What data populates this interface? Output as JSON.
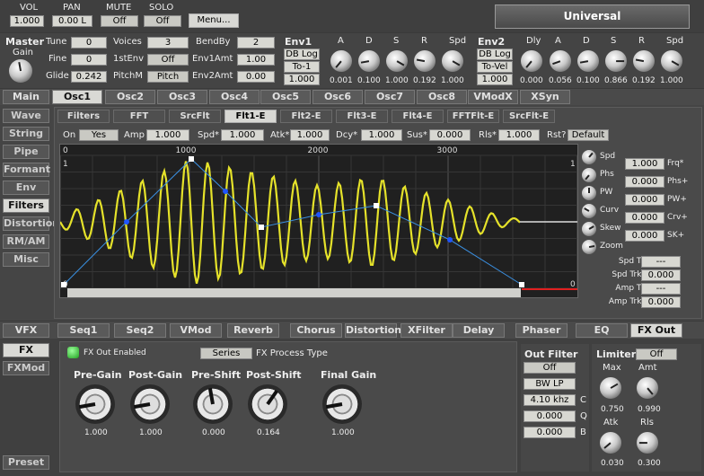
{
  "top": {
    "vol_label": "VOL",
    "vol": "1.000",
    "pan_label": "PAN",
    "pan": "0.00 L",
    "mute_label": "MUTE",
    "mute": "Off",
    "solo_label": "SOLO",
    "solo": "Off",
    "menu": "Menu...",
    "patch": "Universal"
  },
  "master": {
    "title": "Master",
    "gain": "Gain"
  },
  "params": {
    "tune_l": "Tune",
    "tune": "0",
    "fine_l": "Fine",
    "fine": "0",
    "glide_l": "Glide",
    "glide": "0.242",
    "voices_l": "Voices",
    "voices": "3",
    "firstenv_l": "1stEnv",
    "firstenv": "Off",
    "pitchm_l": "PitchM",
    "pitchm": "Pitch",
    "bendby_l": "BendBy",
    "bendby": "2",
    "env1amt_l": "Env1Amt",
    "env1amt": "1.00",
    "env2amt_l": "Env2Amt",
    "env2amt": "0.00"
  },
  "env1": {
    "title": "Env1",
    "mode": "DB Log",
    "target": "To-1",
    "val": "1.000",
    "labels": [
      "A",
      "D",
      "S",
      "R",
      "Spd"
    ],
    "values": [
      "0.001",
      "0.100",
      "1.000",
      "0.192",
      "1.000"
    ]
  },
  "env2": {
    "title": "Env2",
    "mode": "DB Log",
    "target": "To-Vel",
    "val": "1.000",
    "labels": [
      "Dly",
      "A",
      "D",
      "S",
      "R",
      "Spd"
    ],
    "values": [
      "0.000",
      "0.056",
      "0.100",
      "0.866",
      "0.192",
      "1.000"
    ]
  },
  "main_tabs": [
    "Main",
    "Osc1",
    "Osc2",
    "Osc3",
    "Osc4",
    "Osc5",
    "Osc6",
    "Osc7",
    "Osc8",
    "VModX",
    "XSyn"
  ],
  "side_tabs": [
    "Wave",
    "String",
    "Pipe",
    "Formant",
    "Env",
    "Filters",
    "Distortion",
    "RM/AM",
    "Misc"
  ],
  "filter_tabs": [
    "Filters",
    "FFT",
    "SrcFlt",
    "Flt1-E",
    "Flt2-E",
    "Flt3-E",
    "Flt4-E",
    "FFTFlt-E",
    "SrcFlt-E"
  ],
  "envrow": {
    "on_l": "On",
    "on": "Yes",
    "amp_l": "Amp",
    "amp": "1.000",
    "spd_l": "Spd*",
    "spd": "1.000",
    "atk_l": "Atk*",
    "atk": "1.000",
    "dcy_l": "Dcy*",
    "dcy": "1.000",
    "sus_l": "Sus*",
    "sus": "0.000",
    "rls_l": "Rls*",
    "rls": "1.000",
    "rst_l": "Rst?",
    "rst": "Default"
  },
  "graph": {
    "ticks": [
      "0",
      "1000",
      "2000",
      "3000"
    ],
    "corner_tl": "1",
    "corner_tr": "1",
    "corner_bl": "0",
    "corner_br": "0"
  },
  "rightknobs": [
    {
      "label": "Spd"
    },
    {
      "label": "Phs"
    },
    {
      "label": "PW"
    },
    {
      "label": "Curv"
    },
    {
      "label": "Skew"
    },
    {
      "label": "Zoom"
    }
  ],
  "rightfields": [
    {
      "label": "Frq*",
      "value": "1.000"
    },
    {
      "label": "Phs+",
      "value": "0.000"
    },
    {
      "label": "PW+",
      "value": "0.000"
    },
    {
      "label": "Crv+",
      "value": "0.000"
    },
    {
      "label": "SK+",
      "value": "0.000"
    }
  ],
  "trk": [
    {
      "label": "Spd Trk",
      "value": "---"
    },
    {
      "label": "Spd Trk+",
      "value": "0.000"
    },
    {
      "label": "Amp Trk",
      "value": "---"
    },
    {
      "label": "Amp Trk+",
      "value": "0.000"
    }
  ],
  "fx_tabs": [
    "VFX",
    "Seq1",
    "Seq2",
    "VMod",
    "Reverb",
    "Chorus",
    "Distortion",
    "XFilter",
    "Delay",
    "Phaser",
    "EQ",
    "FX Out"
  ],
  "fx_side": [
    "FX",
    "FXMod"
  ],
  "preset": "Preset",
  "fxout": {
    "enabled": "FX Out Enabled",
    "series": "Series",
    "process": "FX Process Type",
    "knobs": [
      {
        "label": "Pre-Gain",
        "value": "1.000"
      },
      {
        "label": "Post-Gain",
        "value": "1.000"
      },
      {
        "label": "Pre-Shift",
        "value": "0.000"
      },
      {
        "label": "Post-Shift",
        "value": "0.164"
      },
      {
        "label": "Final Gain",
        "value": "1.000"
      }
    ]
  },
  "outfilter": {
    "title": "Out Filter",
    "on": "Off",
    "type": "BW LP",
    "freq": "4.10 khz",
    "freq_l": "C",
    "q": "0.000",
    "q_l": "Q",
    "b": "0.000",
    "b_l": "B"
  },
  "limiter": {
    "title": "Limiter",
    "on": "Off",
    "max_l": "Max",
    "amt_l": "Amt",
    "max": "0.750",
    "amt": "0.990",
    "atk_l": "Atk",
    "rls_l": "Rls",
    "atk": "0.030",
    "rls": "0.300"
  }
}
